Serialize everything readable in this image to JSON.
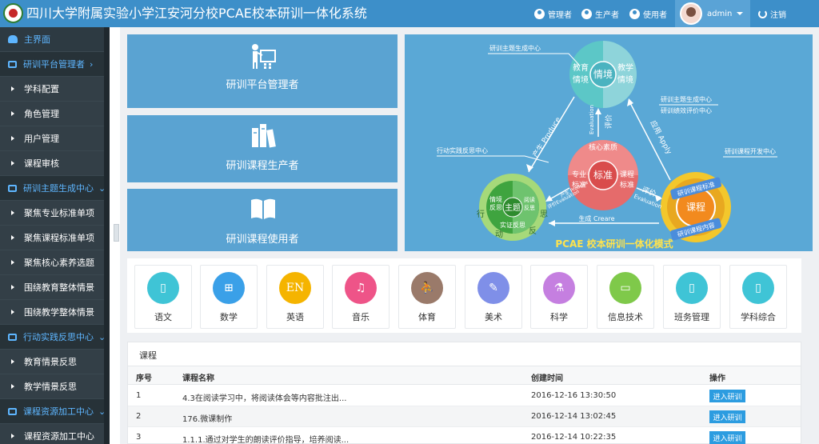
{
  "header": {
    "title": "四川大学附属实验小学江安河分校PCAE校本研训一体化系统",
    "nav": [
      {
        "label": "管理者",
        "icon": "user-icon"
      },
      {
        "label": "生产者",
        "icon": "user-icon"
      },
      {
        "label": "使用者",
        "icon": "users-icon"
      }
    ],
    "username": "admin",
    "logout": "注销"
  },
  "sidebar": {
    "items": [
      {
        "label": "主界面",
        "type": "home"
      },
      {
        "label": "研训平台管理者",
        "type": "group",
        "chevron": "›"
      },
      {
        "label": "学科配置",
        "type": "sub"
      },
      {
        "label": "角色管理",
        "type": "sub"
      },
      {
        "label": "用户管理",
        "type": "sub"
      },
      {
        "label": "课程审核",
        "type": "sub"
      },
      {
        "label": "研训主题生成中心",
        "type": "group",
        "chevron": "⌄"
      },
      {
        "label": "聚焦专业标准单项",
        "type": "sub"
      },
      {
        "label": "聚焦课程标准单项",
        "type": "sub"
      },
      {
        "label": "聚焦核心素养选题",
        "type": "sub"
      },
      {
        "label": "围绕教育整体情景",
        "type": "sub"
      },
      {
        "label": "围绕教学整体情景",
        "type": "sub"
      },
      {
        "label": "行动实践反思中心",
        "type": "group",
        "chevron": "⌄"
      },
      {
        "label": "教育情景反思",
        "type": "sub"
      },
      {
        "label": "教学情景反思",
        "type": "sub"
      },
      {
        "label": "课程资源加工中心",
        "type": "group",
        "chevron": "⌄"
      },
      {
        "label": "课程资源加工中心",
        "type": "sub"
      }
    ]
  },
  "tiles": [
    {
      "label": "研训平台管理者",
      "icon": "presenter-icon"
    },
    {
      "label": "研训课程生产者",
      "icon": "books-icon"
    },
    {
      "label": "研训课程使用者",
      "icon": "open-book-icon"
    }
  ],
  "diagram": {
    "top_circle": {
      "center": "情境",
      "left": "教育\n情境",
      "right": "教学\n情境"
    },
    "center_circle": {
      "top": "核心素质",
      "center": "标准",
      "left": "专业\n标准",
      "right": "课程\n标准"
    },
    "left_circle": {
      "center": "主题",
      "tl": "情境\n反思",
      "tr": "阅读\n反思",
      "bottom": "实证反思",
      "outer_left": "行",
      "outer_bottom": "动",
      "outer_right": "思",
      "outer_br": "反"
    },
    "right_circle": {
      "center": "课程",
      "ring_top": "研训课程标准",
      "ring_bottom": "研训课程内容"
    },
    "callouts": [
      "研训主题生成中心",
      "研训主题生成中心",
      "研训绩效评价中心",
      "行动实践反思中心",
      "研训课程开发中心"
    ],
    "arrows": {
      "produce": "产生 Produce",
      "evaluation_top": "评价",
      "evaluation_top_en": "Evaluation",
      "apply": "应用 Apply",
      "produce_small": "产生 Produce",
      "evaluation_small": "评价Evaluation",
      "evaluation_right": "评价",
      "evaluation_right_en": "Evaluation",
      "create": "生成 Creare"
    },
    "caption": "PCAE 校本研训一体化模式"
  },
  "subjects": [
    {
      "label": "语文",
      "color": "#3fc4d6",
      "icon": "book-icon",
      "glyph": "▯"
    },
    {
      "label": "数学",
      "color": "#3aa0e8",
      "icon": "calculator-icon",
      "glyph": "⊞"
    },
    {
      "label": "英语",
      "color": "#f5b400",
      "icon": "en-icon",
      "glyph": "EN"
    },
    {
      "label": "音乐",
      "color": "#ee5488",
      "icon": "music-icon",
      "glyph": "♫"
    },
    {
      "label": "体育",
      "color": "#9a7a6a",
      "icon": "runner-icon",
      "glyph": "⛹"
    },
    {
      "label": "美术",
      "color": "#7f8fe8",
      "icon": "brush-icon",
      "glyph": "✎"
    },
    {
      "label": "科学",
      "color": "#c57fe0",
      "icon": "flask-icon",
      "glyph": "⚗"
    },
    {
      "label": "信息技术",
      "color": "#7fc94a",
      "icon": "monitor-icon",
      "glyph": "▭"
    },
    {
      "label": "班务管理",
      "color": "#3fc4d6",
      "icon": "book-icon",
      "glyph": "▯"
    },
    {
      "label": "学科综合",
      "color": "#3fc4d6",
      "icon": "book-icon",
      "glyph": "▯"
    }
  ],
  "course": {
    "title": "课程",
    "columns": [
      "序号",
      "课程名称",
      "创建时间",
      "操作"
    ],
    "rows": [
      {
        "no": "1",
        "name": "4.3在阅读学习中，将阅读体会等内容批注出...",
        "time": "2016-12-16 13:30:50",
        "action": "进入研训"
      },
      {
        "no": "2",
        "name": "176.微课制作",
        "time": "2016-12-14 13:02:45",
        "action": "进入研训"
      },
      {
        "no": "3",
        "name": "1.1.1.通过对学生的朗读评价指导，培养阅读...",
        "time": "2016-12-14 10:22:35",
        "action": "进入研训"
      }
    ]
  }
}
